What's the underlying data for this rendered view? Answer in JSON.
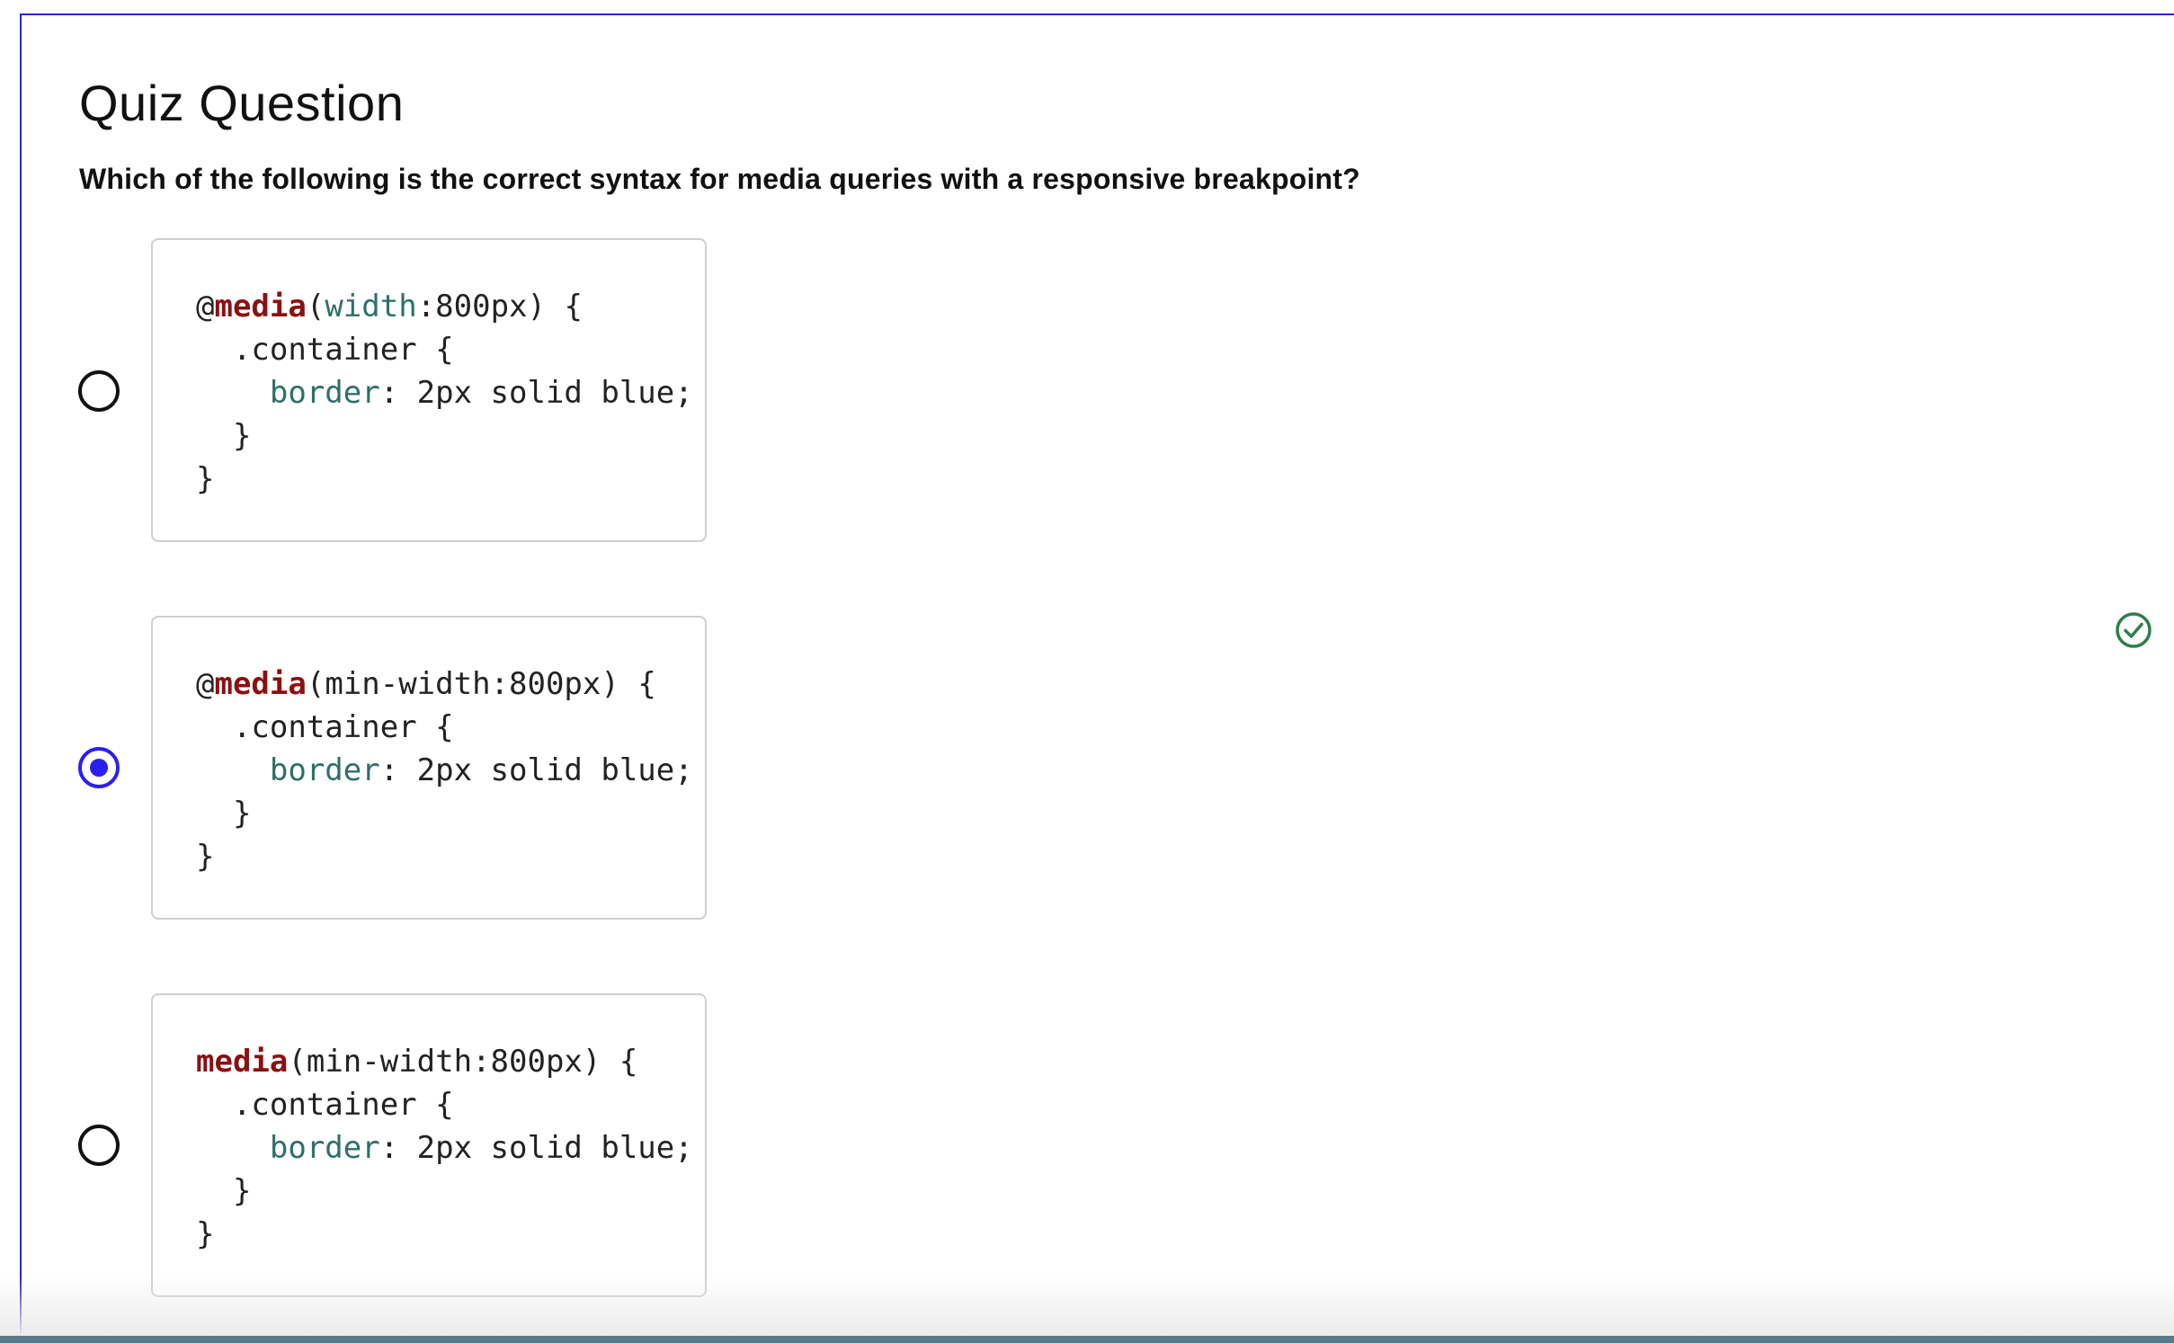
{
  "quiz": {
    "title": "Quiz Question",
    "prompt": "Which of the following is the correct syntax for media queries with a responsive breakpoint?"
  },
  "options": [
    {
      "selected": false,
      "code": {
        "at": "@",
        "keyword": "media",
        "paren_open": "(",
        "feature": "width",
        "feature_rest": ":800px) {",
        "selector_line": "  .container {",
        "prop": "border",
        "prop_rest": ": 2px solid blue;",
        "close_inner": "  }",
        "close_outer": "}"
      }
    },
    {
      "selected": true,
      "code": {
        "at": "@",
        "keyword": "media",
        "paren_open": "(",
        "feature": "",
        "feature_rest": "min-width:800px) {",
        "selector_line": "  .container {",
        "prop": "border",
        "prop_rest": ": 2px solid blue;",
        "close_inner": "  }",
        "close_outer": "}"
      }
    },
    {
      "selected": false,
      "code": {
        "at": "",
        "keyword": "media",
        "paren_open": "(",
        "feature": "",
        "feature_rest": "min-width:800px) {",
        "selector_line": "  .container {",
        "prop": "border",
        "prop_rest": ": 2px solid blue;",
        "close_inner": "  }",
        "close_outer": "}"
      }
    }
  ],
  "status": {
    "icon": "check-circle-icon",
    "color": "#2e7d4f"
  },
  "colors": {
    "accent": "#2b1ff0",
    "keyword": "#8b1010",
    "property": "#2e6f6a"
  }
}
